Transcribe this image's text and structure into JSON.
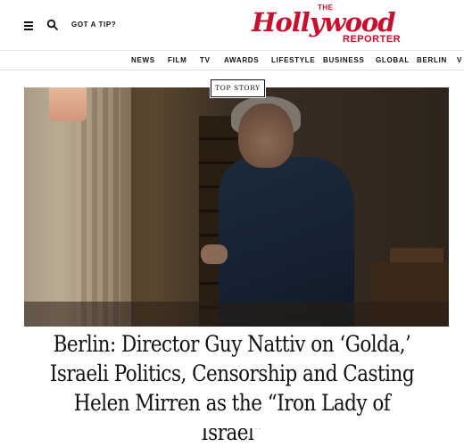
{
  "header": {
    "tip_label": "GOT A TIP?",
    "logo": {
      "the": "THE",
      "word": "Hollywood",
      "reporter": "REPORTER"
    }
  },
  "nav": {
    "items": [
      "NEWS",
      "FILM",
      "TV",
      "AWARDS",
      "LIFESTYLE",
      "BUSINESS",
      "GLOBAL",
      "BERLIN",
      "V"
    ]
  },
  "hero": {
    "badge": "TOP STORY"
  },
  "article": {
    "headline_lines": [
      "Berlin: Director Guy Nattiv on ‘Golda,’",
      "Israeli Politics, Censorship and Casting",
      "Helen Mirren as the “Iron Lady of Israel”"
    ]
  },
  "colors": {
    "brand": "#c8102e",
    "text": "#111111"
  },
  "icons": {
    "menu": "menu-icon",
    "search": "search-icon"
  }
}
